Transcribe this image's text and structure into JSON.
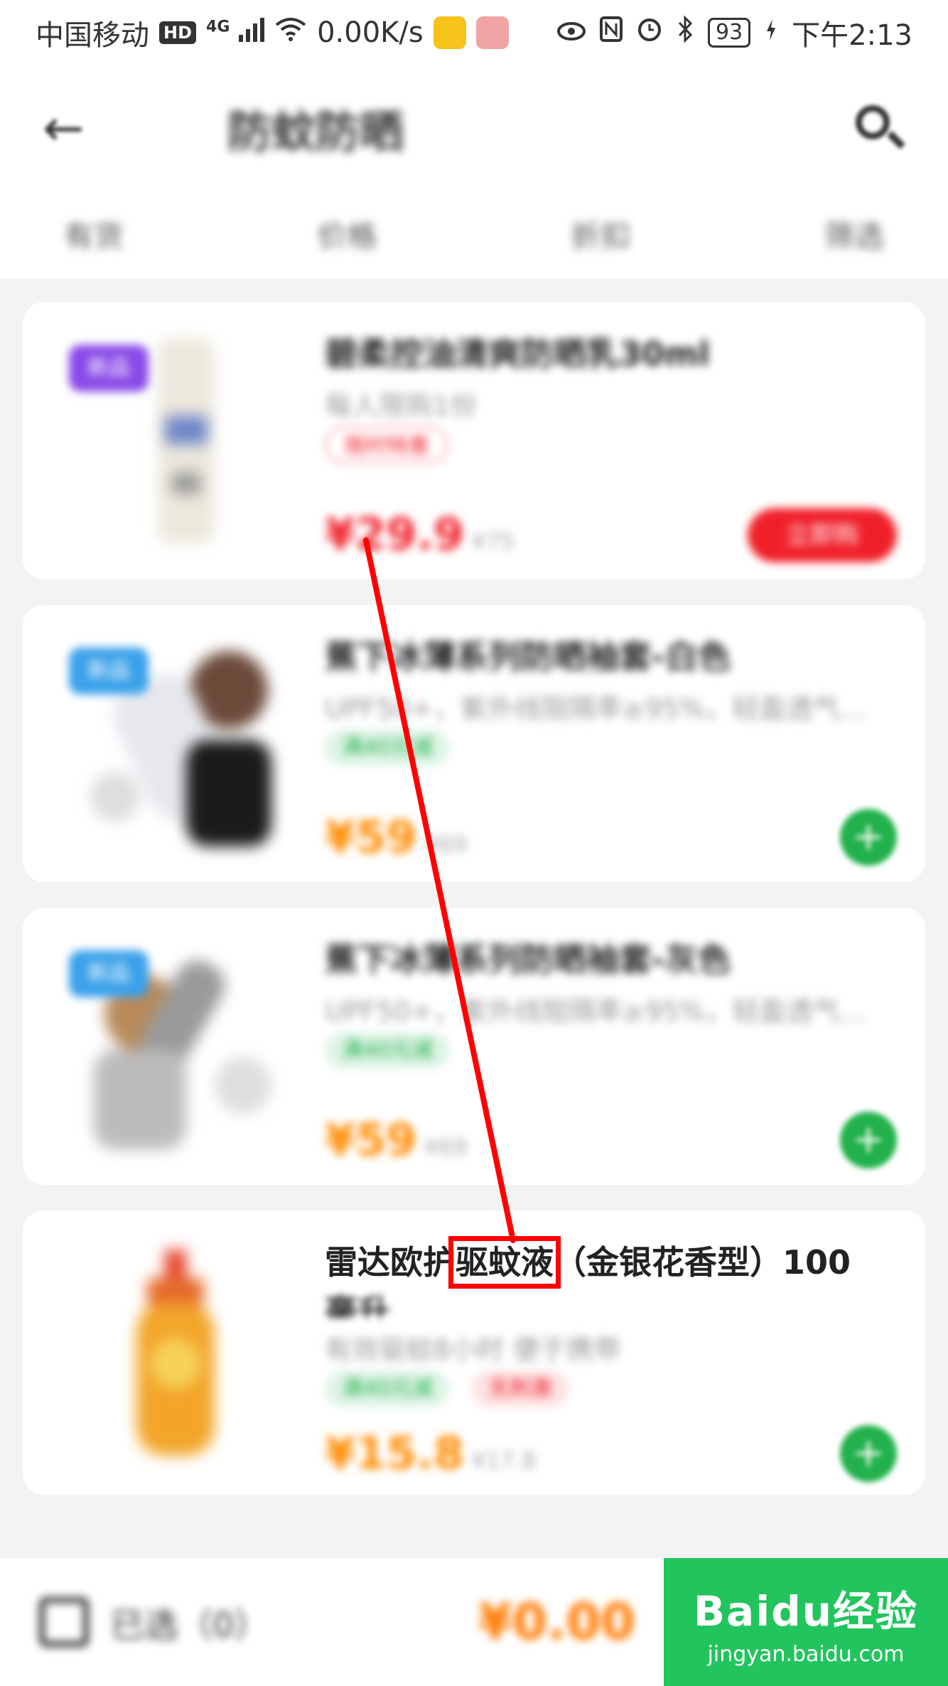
{
  "status_bar": {
    "carrier": "中国移动",
    "hd": "HD",
    "network": "4G",
    "speed": "0.00K/s",
    "battery": "93",
    "time": "下午2:13"
  },
  "header": {
    "title": "防蚊防晒",
    "back_icon": "back-arrow-icon",
    "search_icon": "search-icon"
  },
  "sort_bar": {
    "tabs": [
      "有货",
      "价格",
      "折扣",
      "筛选"
    ]
  },
  "products": [
    {
      "tag": "新品",
      "tag_color": "#8a4be8",
      "name": "碧柔控油清爽防晒乳30ml",
      "subtitle": "每人限购1份",
      "badges": [
        "限时特惠"
      ],
      "price": "¥29.9",
      "orig_price": "¥75",
      "action": "立即购"
    },
    {
      "tag": "新品",
      "tag_color": "#3ba1ea",
      "name": "蕉下冰薄系列防晒袖套-白色",
      "subtitle": "UPF50+，紫外线阻隔率≥95%，轻盈透气...",
      "badges": [
        "满40元减"
      ],
      "price": "¥59",
      "orig_price": "¥69",
      "action": "+"
    },
    {
      "tag": "新品",
      "tag_color": "#3ba1ea",
      "name": "蕉下冰薄系列防晒袖套-灰色",
      "subtitle": "UPF50+，紫外线阻隔率≥95%，轻盈透气...",
      "badges": [
        "满40元减"
      ],
      "price": "¥59",
      "orig_price": "¥69",
      "action": "+"
    },
    {
      "name_before": "雷达欧护",
      "name_highlight": "驱蚊液",
      "name_after": "（金银花香型）100",
      "name_line2": "毫升",
      "subtitle": "有效驱蚊8小时 便于携带",
      "badges": [
        "满40元减",
        "无刺激"
      ],
      "price": "¥15.8",
      "orig_price": "¥17.8",
      "action": "+"
    }
  ],
  "bottom_bar": {
    "cart_label": "已选（0）",
    "total": "¥0.00",
    "watermark_main": "Baidu经验",
    "watermark_url": "jingyan.baidu.com"
  },
  "colors": {
    "price_red": "#f0202a",
    "price_orange": "#ff8a00",
    "accent_green": "#22b14c",
    "annotation_red": "#ff0000"
  }
}
